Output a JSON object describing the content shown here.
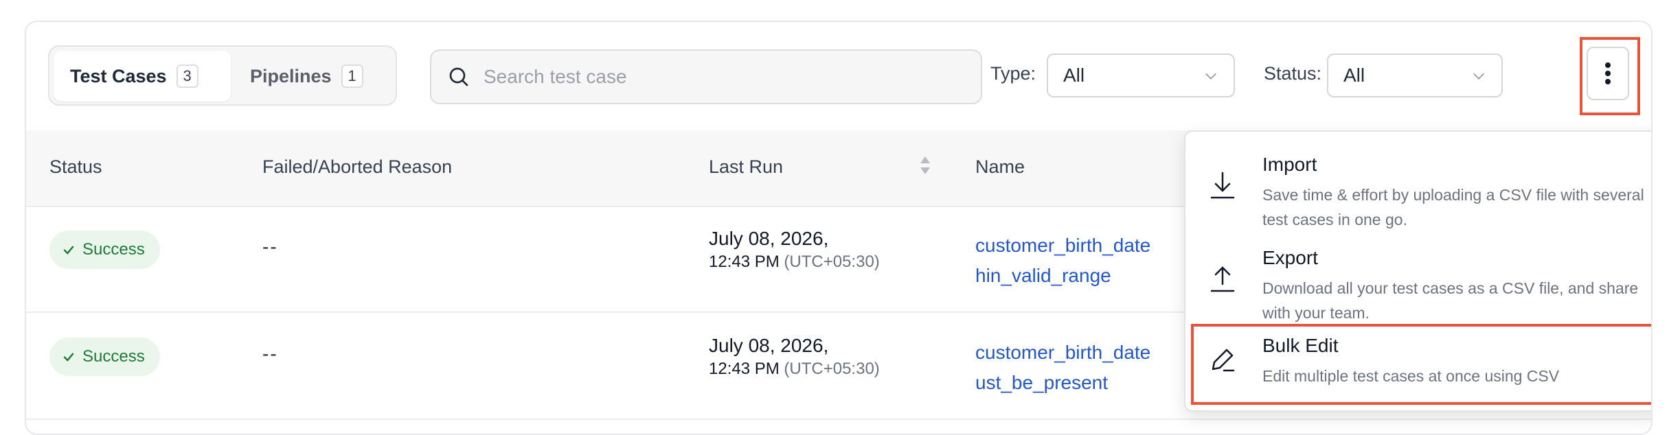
{
  "tabs": [
    {
      "label": "Test Cases",
      "count": "3"
    },
    {
      "label": "Pipelines",
      "count": "1"
    }
  ],
  "search": {
    "placeholder": "Search test case",
    "value": ""
  },
  "filters": {
    "type_label": "Type:",
    "type_value": "All",
    "status_label": "Status:",
    "status_value": "All"
  },
  "table": {
    "headers": [
      "Status",
      "Failed/Aborted Reason",
      "Last Run",
      "Name"
    ],
    "rows": [
      {
        "status": "Success",
        "reason": "--",
        "date": "July 08, 2026,",
        "time": "12:43 PM",
        "tz": "(UTC+05:30)",
        "name_line1": "customer_birth_date",
        "name_line2": "hin_valid_range"
      },
      {
        "status": "Success",
        "reason": "--",
        "date": "July 08, 2026,",
        "time": "12:43 PM",
        "tz": "(UTC+05:30)",
        "name_line1": "customer_birth_date",
        "name_line2": "ust_be_present"
      }
    ]
  },
  "menu": {
    "items": [
      {
        "title": "Import",
        "description": "Save time & effort by uploading a CSV file with several test cases in one go.",
        "icon": "download-icon"
      },
      {
        "title": "Export",
        "description": "Download all your test cases as a CSV file, and share with your team.",
        "icon": "upload-icon"
      },
      {
        "title": "Bulk Edit",
        "description": "Edit multiple test cases at once using CSV",
        "icon": "pencil-icon"
      }
    ]
  },
  "colors": {
    "highlight": "#e8533a",
    "link": "#2357c9",
    "success_bg": "#eaf6ec",
    "success_text": "#1e7a38"
  }
}
